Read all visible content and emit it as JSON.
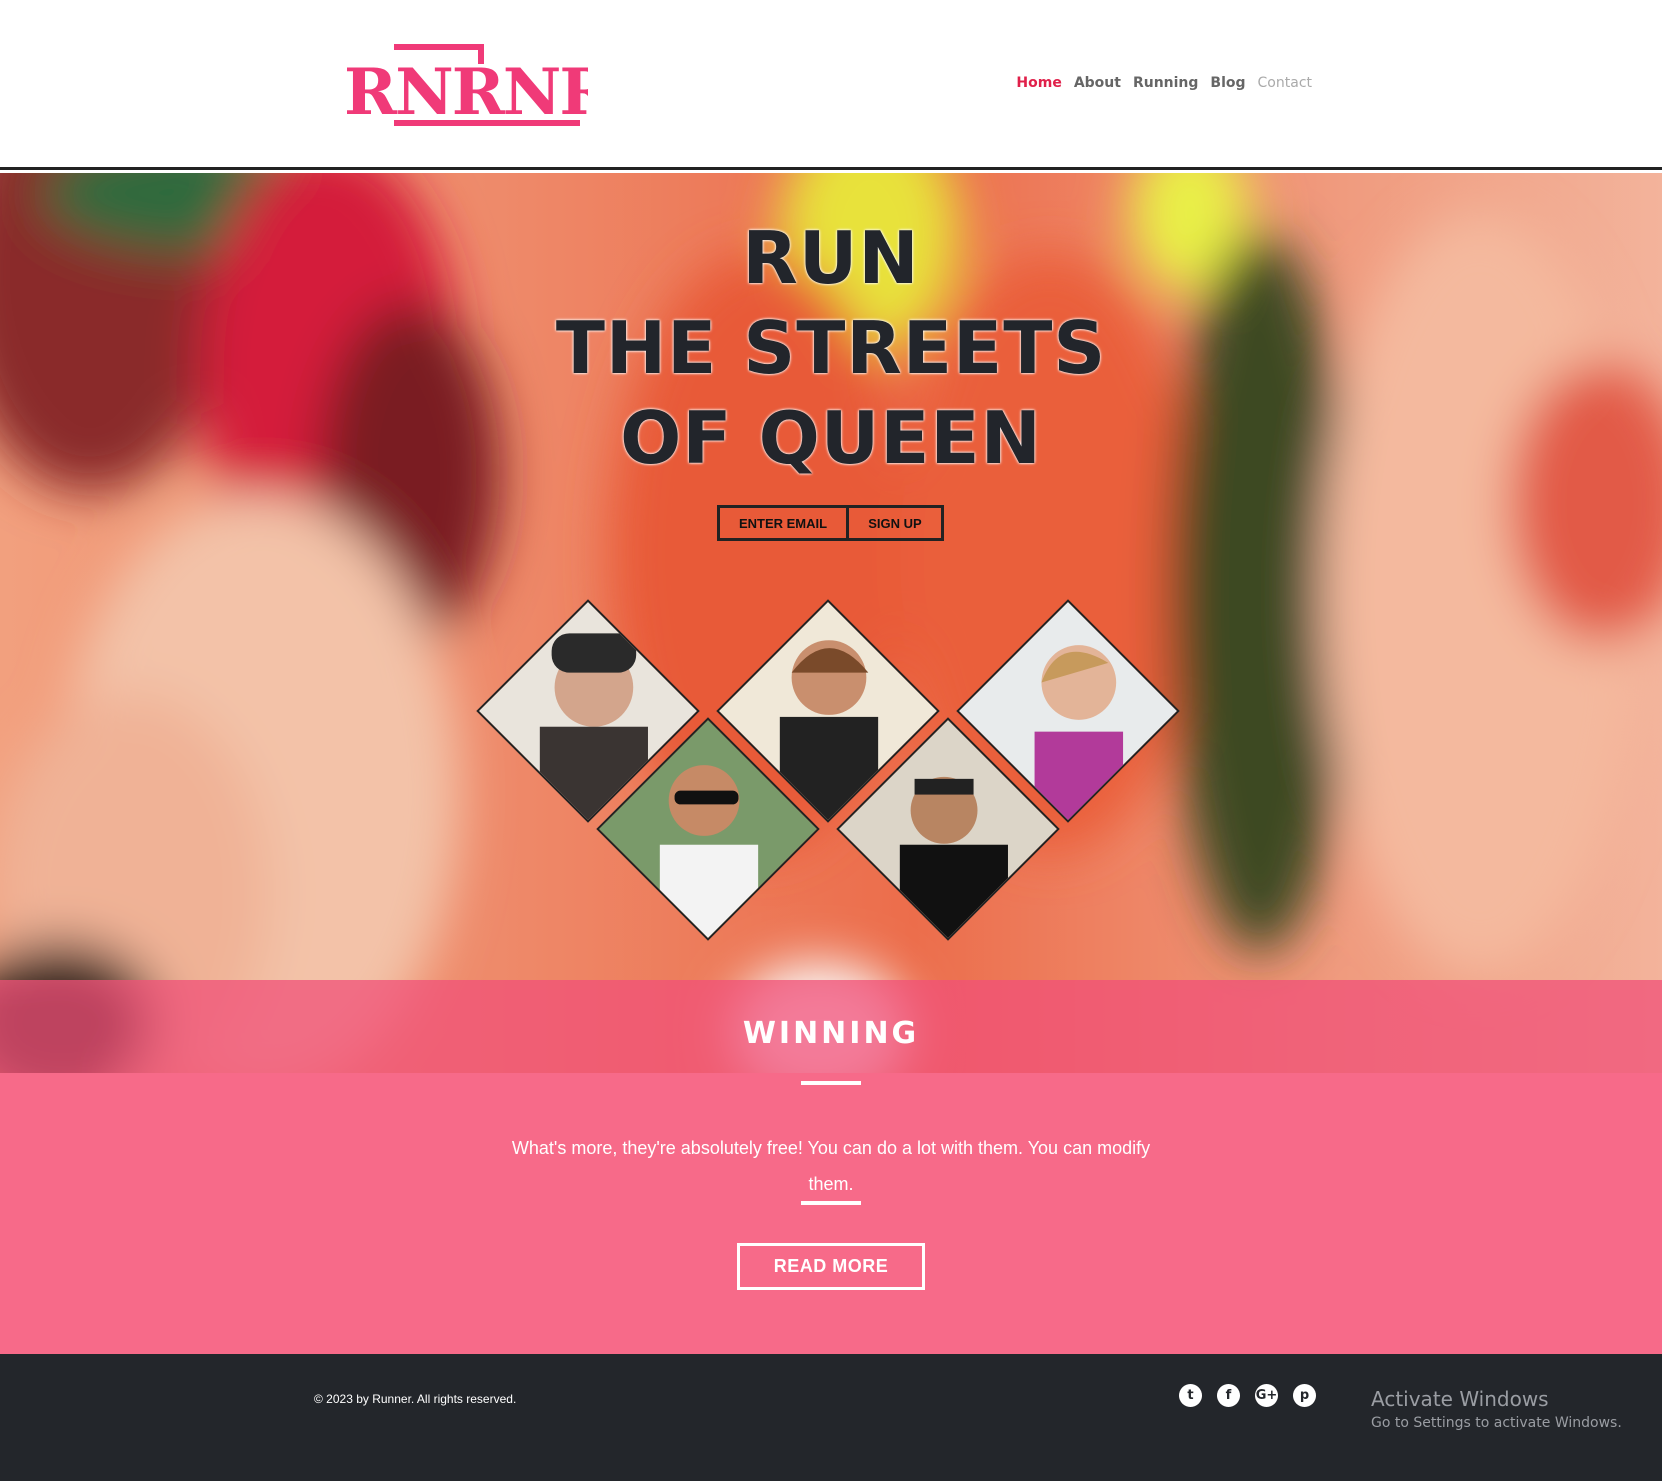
{
  "header": {
    "logo_text": "RNRNR",
    "nav": [
      {
        "label": "Home"
      },
      {
        "label": "About"
      },
      {
        "label": "Running"
      },
      {
        "label": "Blog"
      },
      {
        "label": "Contact"
      }
    ]
  },
  "hero": {
    "title_lines": [
      "RUN",
      "THE STREETS",
      "OF QUEEN"
    ],
    "email_placeholder": "ENTER EMAIL",
    "signup_label": "SIGN UP"
  },
  "winning": {
    "title": "WINNING",
    "paragraph": "What's more, they're absolutely free! You can do a lot with them. You can modify them.",
    "button_label": "READ MORE"
  },
  "footer": {
    "copyright": "© 2023 by Runner. All rights reserved.",
    "socials": [
      {
        "icon": "twitter-icon",
        "glyph": "t"
      },
      {
        "icon": "facebook-icon",
        "glyph": "f"
      },
      {
        "icon": "google-plus-icon",
        "glyph": "G+"
      },
      {
        "icon": "pinterest-icon",
        "glyph": "p"
      }
    ]
  },
  "overlay": {
    "title": "Activate Windows",
    "subtitle": "Go to Settings to activate Windows."
  },
  "colors": {
    "brand": "#f03a78",
    "active_nav": "#e0204a",
    "pink_section": "#f76a89",
    "footer_bg": "#23262b"
  }
}
